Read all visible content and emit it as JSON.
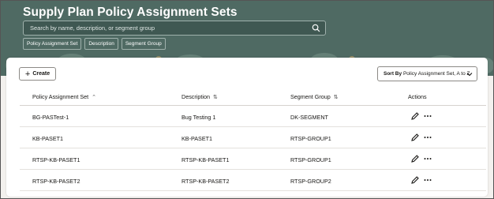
{
  "header": {
    "title": "Supply Plan Policy Assignment Sets",
    "search_placeholder": "Search by name, description, or segment group",
    "chips": [
      "Policy Assignment Set",
      "Description",
      "Segment Group"
    ]
  },
  "toolbar": {
    "create_label": "Create",
    "sort_label": "Sort By",
    "sort_value": "Policy Assignment Set, A to Z"
  },
  "table": {
    "headers": {
      "set": "Policy Assignment Set",
      "description": "Description",
      "segment": "Segment Group",
      "actions": "Actions"
    },
    "rows": [
      {
        "set": "BG-PASTest-1",
        "description": "Bug Testing 1",
        "segment": "DK-SEGMENT"
      },
      {
        "set": "KB-PASET1",
        "description": "KB-PASET1",
        "segment": "RTSP-GROUP1"
      },
      {
        "set": "RTSP-KB-PASET1",
        "description": "RTSP-KB-PASET1",
        "segment": "RTSP-GROUP1"
      },
      {
        "set": "RTSP-KB-PASET2",
        "description": "RTSP-KB-PASET2",
        "segment": "RTSP-GROUP2"
      }
    ]
  },
  "icons": {
    "search": "search-icon",
    "create": "plus-icon",
    "sort_chevron": "chevron-down-icon",
    "edit": "pencil-icon",
    "more": "more-horizontal-icon"
  },
  "colors": {
    "banner": "#4f6a63",
    "background": "#f3f1ee",
    "text": "#161513"
  }
}
